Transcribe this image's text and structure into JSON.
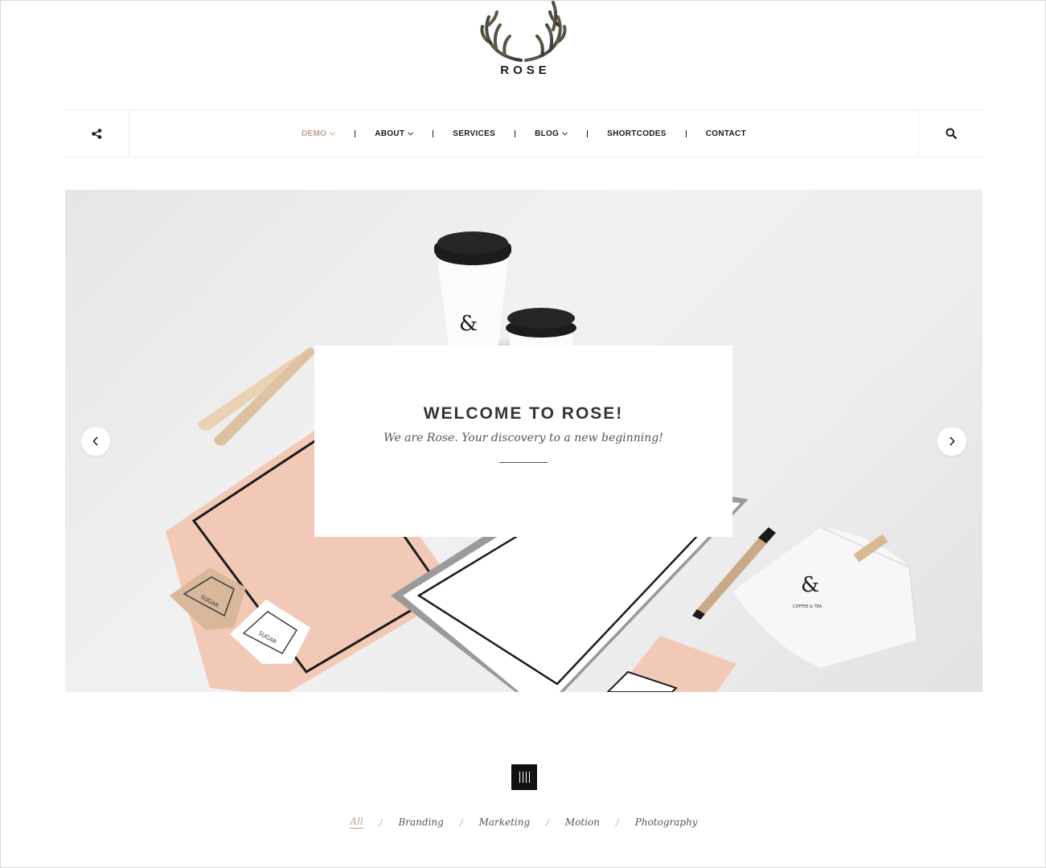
{
  "logo": {
    "text": "ROSE",
    "icon": "antlers-icon"
  },
  "nav": {
    "share_icon": "share-icon",
    "search_icon": "search-icon",
    "items": [
      {
        "label": "DEMO",
        "active": true,
        "has_dropdown": true
      },
      {
        "label": "ABOUT",
        "active": false,
        "has_dropdown": true
      },
      {
        "label": "SERVICES",
        "active": false,
        "has_dropdown": false
      },
      {
        "label": "BLOG",
        "active": false,
        "has_dropdown": true
      },
      {
        "label": "SHORTCODES",
        "active": false,
        "has_dropdown": false
      },
      {
        "label": "CONTACT",
        "active": false,
        "has_dropdown": false
      }
    ],
    "active_color": "#c39d84"
  },
  "hero": {
    "title": "WELCOME TO ROSE!",
    "subtitle": "We are Rose. Your discovery to a new beginning!",
    "prev_icon": "chevron-left-icon",
    "next_icon": "chevron-right-icon",
    "image_labels": {
      "sugar": "SUGAR",
      "brand": "COFFEE & TEA"
    }
  },
  "portfolio": {
    "grid_icon": "grid-view-icon",
    "filters": [
      "All",
      "Branding",
      "Marketing",
      "Motion",
      "Photography"
    ],
    "active_filter": "All",
    "separator": "/"
  },
  "colors": {
    "accent": "#c39d84",
    "pink": "#f2c9b6",
    "dark": "#111111"
  }
}
